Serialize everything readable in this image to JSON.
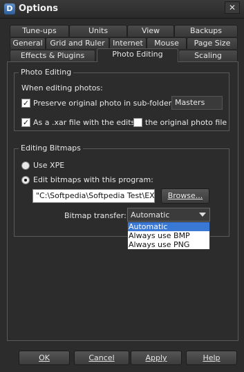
{
  "window": {
    "app_icon_letter": "D",
    "title": "Options",
    "close_glyph": "✕"
  },
  "tabs": {
    "row1": [
      "Tune-ups",
      "Units",
      "View",
      "Backups"
    ],
    "row2": [
      "General",
      "Grid and Ruler",
      "Internet",
      "Mouse",
      "Page Size"
    ],
    "row3": [
      "Effects & Plugins",
      "Photo Editing",
      "Scaling"
    ],
    "active": "Photo Editing"
  },
  "photo_editing": {
    "group_title": "Photo Editing",
    "when_editing_label": "When editing photos:",
    "preserve_label": "Preserve original photo in sub-folder:",
    "preserve_checked": true,
    "folder_value": "Masters",
    "xar_label": "As a .xar file with the edits",
    "xar_checked": true,
    "original_label": "the original photo file",
    "original_checked": false
  },
  "editing_bitmaps": {
    "group_title": "Editing Bitmaps",
    "use_xpe_label": "Use XPE",
    "use_xpe_selected": false,
    "edit_with_program_label": "Edit bitmaps with this program:",
    "edit_with_program_selected": true,
    "program_path": "\"C:\\Softpedia\\Softpedia Test\\EXE\\",
    "browse_label": "Browse...",
    "bitmap_transfer_label": "Bitmap transfer:",
    "bitmap_transfer_value": "Automatic",
    "bitmap_transfer_options": [
      "Automatic",
      "Always use BMP",
      "Always use PNG"
    ],
    "bitmap_transfer_selected_index": 0
  },
  "footer": {
    "ok": "OK",
    "cancel": "Cancel",
    "apply": "Apply",
    "help": "Help"
  }
}
